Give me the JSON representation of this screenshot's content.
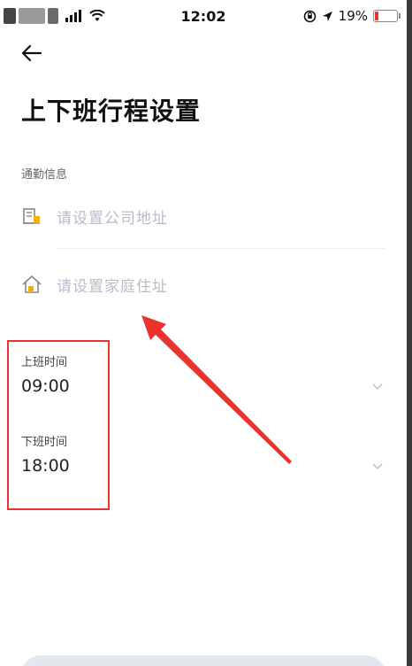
{
  "status_bar": {
    "time": "12:02",
    "battery_percent": "19%",
    "battery_level": 0.19
  },
  "header": {
    "title": "上下班行程设置"
  },
  "commute_info": {
    "section_label": "通勤信息",
    "company_placeholder": "请设置公司地址",
    "home_placeholder": "请设置家庭住址"
  },
  "work_start": {
    "label": "上班时间",
    "value": "09:00"
  },
  "work_end": {
    "label": "下班时间",
    "value": "18:00"
  },
  "colors": {
    "annotation_red": "#e8332f",
    "placeholder_gray": "#b8bcc8",
    "icon_gold": "#f0b400"
  },
  "icons": {
    "back": "back-arrow-icon",
    "company": "building-icon",
    "home": "home-icon",
    "chevron": "chevron-down-icon"
  }
}
